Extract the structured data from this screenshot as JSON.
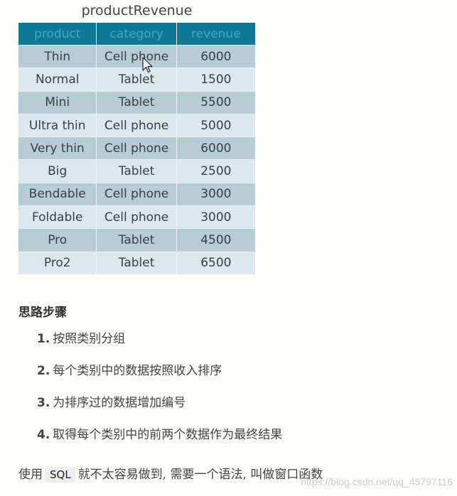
{
  "table": {
    "title": "productRevenue",
    "headers": [
      "product",
      "category",
      "revenue"
    ],
    "rows": [
      [
        "Thin",
        "Cell phone",
        "6000"
      ],
      [
        "Normal",
        "Tablet",
        "1500"
      ],
      [
        "Mini",
        "Tablet",
        "5500"
      ],
      [
        "Ultra thin",
        "Cell phone",
        "5000"
      ],
      [
        "Very thin",
        "Cell phone",
        "6000"
      ],
      [
        "Big",
        "Tablet",
        "2500"
      ],
      [
        "Bendable",
        "Cell phone",
        "3000"
      ],
      [
        "Foldable",
        "Cell phone",
        "3000"
      ],
      [
        "Pro",
        "Tablet",
        "4500"
      ],
      [
        "Pro2",
        "Tablet",
        "6500"
      ]
    ],
    "colors": {
      "header_bg": "#0f7895",
      "header_text": "#3fa8c2",
      "row_odd": "#b7cdd5",
      "row_even": "#dce8ed"
    }
  },
  "steps": {
    "heading": "思路步骤",
    "items": [
      {
        "num": "1.",
        "text": "按照类别分组"
      },
      {
        "num": "2.",
        "text": "每个类别中的数据按照收入排序"
      },
      {
        "num": "3.",
        "text": "为排序过的数据增加编号"
      },
      {
        "num": "4.",
        "text": "取得每个类别中的前两个数据作为最终结果"
      }
    ]
  },
  "note": {
    "before": "使用",
    "code": "SQL",
    "after": "就不太容易做到, 需要一个语法, 叫做窗口函数"
  },
  "watermark": "https://blog.csdn.net/qq_45797116",
  "cursor": "arrow-pointer-icon"
}
